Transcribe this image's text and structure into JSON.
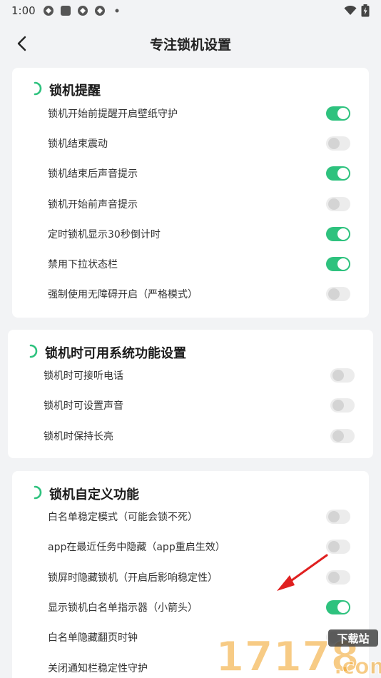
{
  "status": {
    "time": "1:00",
    "icons": [
      "app-icon",
      "square-icon",
      "app-icon",
      "app-icon",
      "dot-icon"
    ]
  },
  "header": {
    "title": "专注锁机设置"
  },
  "sections": [
    {
      "title": "锁机提醒",
      "items": [
        {
          "label": "锁机开始前提醒开启壁纸守护",
          "on": true
        },
        {
          "label": "锁机结束震动",
          "on": false
        },
        {
          "label": "锁机结束后声音提示",
          "on": true
        },
        {
          "label": "锁机开始前声音提示",
          "on": false
        },
        {
          "label": "定时锁机显示30秒倒计时",
          "on": true
        },
        {
          "label": "禁用下拉状态栏",
          "on": true
        },
        {
          "label": "强制使用无障碍开启（严格模式）",
          "on": false
        }
      ]
    },
    {
      "title": "锁机时可用系统功能设置",
      "items": [
        {
          "label": "锁机时可接听电话",
          "on": false
        },
        {
          "label": "锁机时可设置声音",
          "on": false
        },
        {
          "label": "锁机时保持长亮",
          "on": false
        }
      ]
    },
    {
      "title": "锁机自定义功能",
      "items": [
        {
          "label": "白名单稳定模式（可能会锁不死）",
          "on": false
        },
        {
          "label": "app在最近任务中隐藏（app重启生效）",
          "on": false
        },
        {
          "label": "锁屏时隐藏锁机（开启后影响稳定性）",
          "on": false
        },
        {
          "label": "显示锁机白名单指示器（小箭头）",
          "on": true
        },
        {
          "label": "白名单隐藏翻页时钟",
          "on": false
        },
        {
          "label": "关闭通知栏稳定性守护",
          "on": false
        }
      ]
    }
  ],
  "colors": {
    "accent": "#2ec27e",
    "arrow": "#e02020",
    "watermark_orange": "#f0a020"
  },
  "watermark": {
    "number": "17178",
    "badge": "下载站",
    "domain": ".com"
  }
}
